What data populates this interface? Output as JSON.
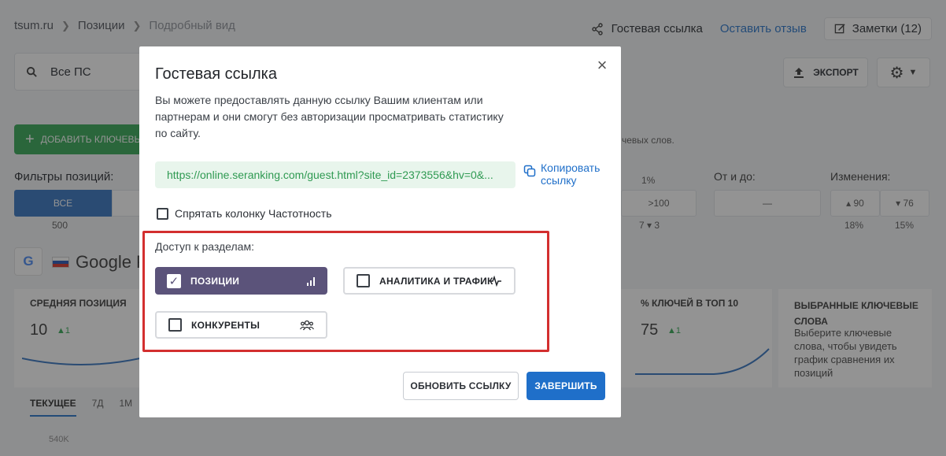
{
  "header": {
    "breadcrumbs": [
      "tsum.ru",
      "Позиции",
      "Подробный вид"
    ],
    "guest_link": "Гостевая ссылка",
    "feedback": "Оставить отзыв",
    "notes": "Заметки (12)"
  },
  "toolbar": {
    "search_value": "Все ПС",
    "export_label": "ЭКСПОРТ",
    "add_keywords": "ДОБАВИТЬ КЛЮЧЕВЫ",
    "side_note": "чевых слов."
  },
  "filters": {
    "label": "Фильтры позиций:",
    "all_label": "ВСЕ",
    "all_count": "500",
    "pct": "1%",
    "gt100": ">100",
    "gt100_sub": "7 ▾ 3",
    "range_label": "От и до:",
    "range_dash": "—",
    "changes_label": "Изменения:",
    "up": "▴ 90",
    "down": "▾ 76",
    "up_pct": "18%",
    "down_pct": "15%"
  },
  "engine": {
    "logo": "G",
    "name": "Google P"
  },
  "cards": {
    "avg_title": "СРЕДНЯЯ ПОЗИЦИЯ",
    "avg_value": "10",
    "avg_delta": "▲1",
    "top10_title": "% КЛЮЧЕЙ В ТОП 10",
    "top10_value": "75",
    "top10_delta": "▲1",
    "selected_title": "ВЫБРАННЫЕ КЛЮЧЕВЫЕ СЛОВА",
    "selected_text": "Выберите ключевые слова, чтобы увидеть график сравнения их позиций"
  },
  "period_tabs": [
    "ТЕКУЩЕЕ",
    "7Д",
    "1М"
  ],
  "axis_label": "540K",
  "modal": {
    "title": "Гостевая ссылка",
    "close": "×",
    "description": "Вы можете предоставлять данную ссылку Вашим клиентам или партнерам и они смогут без авторизации просматривать статистику по сайту.",
    "link": "https://online.seranking.com/guest.html?site_id=2373556&hv=0&...",
    "copy_label": "Копировать ссылку",
    "hide_frequency": "Спрятать колонку Частотность",
    "access_label": "Доступ к разделам:",
    "options": {
      "positions": "ПОЗИЦИИ",
      "analytics": "АНАЛИТИКА И ТРАФИК",
      "competitors": "КОНКУРЕНТЫ"
    },
    "refresh_button": "ОБНОВИТЬ ССЫЛКУ",
    "finish_button": "ЗАВЕРШИТЬ"
  },
  "colors": {
    "accent": "#1f6fc9",
    "selected_option": "#5b537a",
    "highlight_border": "#d32f2f",
    "link_bg": "#e8f5ec",
    "link_text": "#2f9a52"
  }
}
